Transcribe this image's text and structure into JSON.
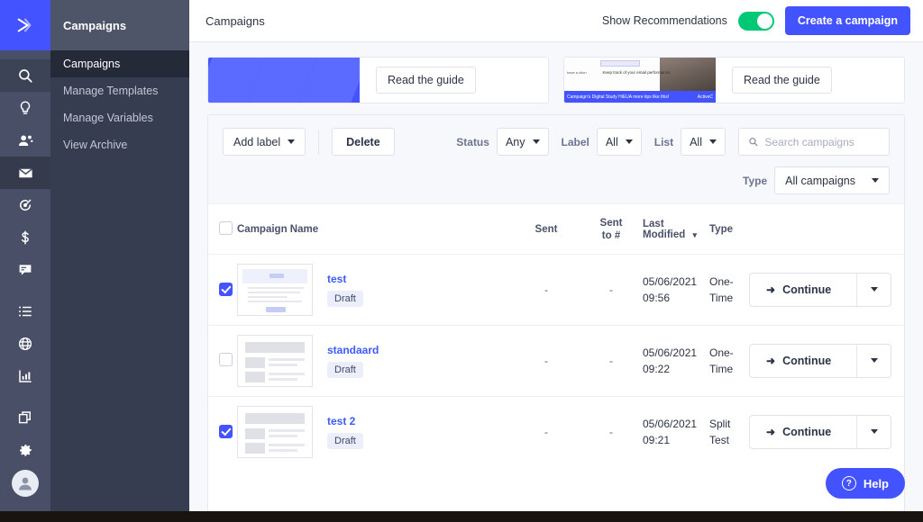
{
  "app": {
    "logo_icon": "send-arrow-icon"
  },
  "rail": {
    "items": [
      {
        "icon": "search-icon",
        "name": "search",
        "state": "selected"
      },
      {
        "icon": "lightbulb-icon",
        "name": "insights",
        "state": "normal"
      },
      {
        "icon": "contacts-icon",
        "name": "contacts",
        "state": "normal"
      },
      {
        "icon": "envelope-icon",
        "name": "campaigns",
        "state": "active"
      },
      {
        "icon": "target-icon",
        "name": "automations",
        "state": "normal"
      },
      {
        "icon": "dollar-icon",
        "name": "deals",
        "state": "normal"
      },
      {
        "icon": "chat-icon",
        "name": "conversations",
        "state": "normal"
      },
      {
        "icon": "list-icon",
        "name": "lists",
        "state": "normal"
      },
      {
        "icon": "globe-icon",
        "name": "website",
        "state": "normal"
      },
      {
        "icon": "bar-chart-icon",
        "name": "reports",
        "state": "normal"
      },
      {
        "icon": "copy-icon",
        "name": "apps",
        "state": "normal"
      },
      {
        "icon": "gear-icon",
        "name": "settings",
        "state": "normal"
      }
    ],
    "avatar_icon": "user-avatar-icon"
  },
  "sidebar": {
    "title": "Campaigns",
    "items": [
      {
        "label": "Campaigns",
        "active": true
      },
      {
        "label": "Manage Templates",
        "active": false
      },
      {
        "label": "Manage Variables",
        "active": false
      },
      {
        "label": "View Archive",
        "active": false
      }
    ]
  },
  "topbar": {
    "title": "Campaigns",
    "recommendations_label": "Show Recommendations",
    "recommendations_on": true,
    "create_button": "Create a campaign",
    "accent_color": "#4353ff",
    "toggle_on_color": "#00c875"
  },
  "recommendations": [
    {
      "name": "guide-card-1",
      "button": "Read the guide",
      "thumb_kind": "chevron-graphic"
    },
    {
      "name": "guide-card-2",
      "button": "Read the guide",
      "thumb_kind": "email-preview",
      "thumb_text_left": "have a\nction",
      "thumb_text_center": "Keep track of your email performance",
      "thumb_bar_left": "Campaign's Digital Study HiEUA more tips like this!",
      "thumb_bar_right": "ActiveC"
    }
  ],
  "filters": {
    "add_label_button": "Add label",
    "delete_button": "Delete",
    "status_label": "Status",
    "status_value": "Any",
    "label_label": "Label",
    "label_value": "All",
    "list_label": "List",
    "list_value": "All",
    "search_placeholder": "Search campaigns",
    "search_value": "",
    "type_label": "Type",
    "type_value": "All campaigns"
  },
  "table": {
    "header_checkbox_checked": false,
    "columns": [
      "Campaign Name",
      "Sent",
      "Sent\nto #",
      "Last Modified",
      "Type"
    ],
    "sort_column": "Last Modified",
    "sort_indicator": "▾",
    "rows": [
      {
        "checked": true,
        "thumb": "doc-preview",
        "name": "test",
        "status_badge": "Draft",
        "sent": "-",
        "sent_to": "-",
        "last_modified_date": "05/06/2021",
        "last_modified_time": "09:56",
        "type_line1": "One-",
        "type_line2": "Time",
        "action_label": "Continue",
        "action_icon": "arrow-right-icon"
      },
      {
        "checked": false,
        "thumb": "blocks-preview",
        "name": "standaard",
        "status_badge": "Draft",
        "sent": "-",
        "sent_to": "-",
        "last_modified_date": "05/06/2021",
        "last_modified_time": "09:22",
        "type_line1": "One-",
        "type_line2": "Time",
        "action_label": "Continue",
        "action_icon": "arrow-right-icon"
      },
      {
        "checked": true,
        "thumb": "blocks-preview",
        "name": "test 2",
        "status_badge": "Draft",
        "sent": "-",
        "sent_to": "-",
        "last_modified_date": "05/06/2021",
        "last_modified_time": "09:21",
        "type_line1": "Split",
        "type_line2": "Test",
        "action_label": "Continue",
        "action_icon": "arrow-right-icon"
      }
    ]
  },
  "help": {
    "label": "Help",
    "icon": "question-circle-icon",
    "mark": "?"
  }
}
